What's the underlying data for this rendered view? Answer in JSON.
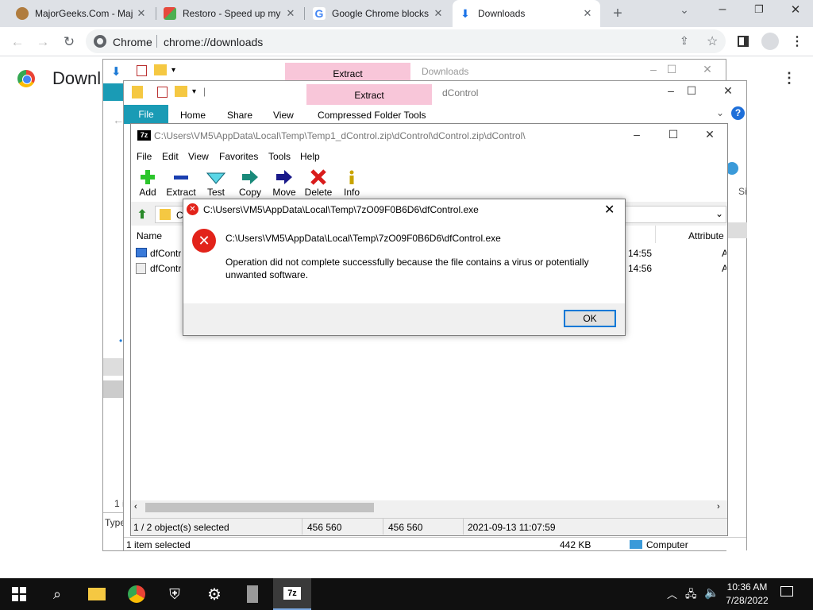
{
  "chrome": {
    "tabs": [
      {
        "label": "MajorGeeks.Com - Maj"
      },
      {
        "label": "Restoro - Speed up my"
      },
      {
        "label": "Google Chrome blocks"
      },
      {
        "label": "Downloads"
      }
    ],
    "omnibox": {
      "site": "Chrome",
      "url": "chrome://downloads"
    },
    "page_heading": "Downl"
  },
  "explorer_back": {
    "title": "Downloads",
    "ribbon_extract": "Extract",
    "side_labels": [
      "1 i",
      "Type"
    ]
  },
  "explorer_front": {
    "title": "dControl",
    "ribbon_extract": "Extract",
    "tabs": {
      "file": "File",
      "home": "Home",
      "share": "Share",
      "view": "View",
      "tools": "Compressed Folder Tools"
    },
    "right_col": "Si",
    "status": {
      "selected": "1 item selected",
      "size": "442 KB",
      "location": "Computer"
    }
  },
  "zip": {
    "title": "C:\\Users\\VM5\\AppData\\Local\\Temp\\Temp1_dControl.zip\\dControl\\dControl.zip\\dControl\\",
    "app_icon": "7z",
    "menu": [
      "File",
      "Edit",
      "View",
      "Favorites",
      "Tools",
      "Help"
    ],
    "toolbar": {
      "add": "Add",
      "extract": "Extract",
      "test": "Test",
      "copy": "Copy",
      "move": "Move",
      "delete": "Delete",
      "info": "Info"
    },
    "address": "C",
    "columns": {
      "name": "Name",
      "attributes": "Attribute"
    },
    "rows": [
      {
        "name": "dfContr",
        "time": "3 14:55",
        "attr": "A"
      },
      {
        "name": "dfContr",
        "time": "3 14:56",
        "attr": "A"
      }
    ],
    "status": {
      "selected": "1 / 2 object(s) selected",
      "size": "456 560",
      "packed": "456 560",
      "modified": "2021-09-13 11:07:59"
    }
  },
  "dialog": {
    "title": "C:\\Users\\VM5\\AppData\\Local\\Temp\\7zO09F0B6D6\\dfControl.exe",
    "path": "C:\\Users\\VM5\\AppData\\Local\\Temp\\7zO09F0B6D6\\dfControl.exe",
    "message": "Operation did not complete successfully because the file contains a virus or potentially unwanted software.",
    "ok_label": "OK"
  },
  "taskbar": {
    "time": "10:36 AM",
    "date": "7/28/2022",
    "zip_label": "7z"
  }
}
